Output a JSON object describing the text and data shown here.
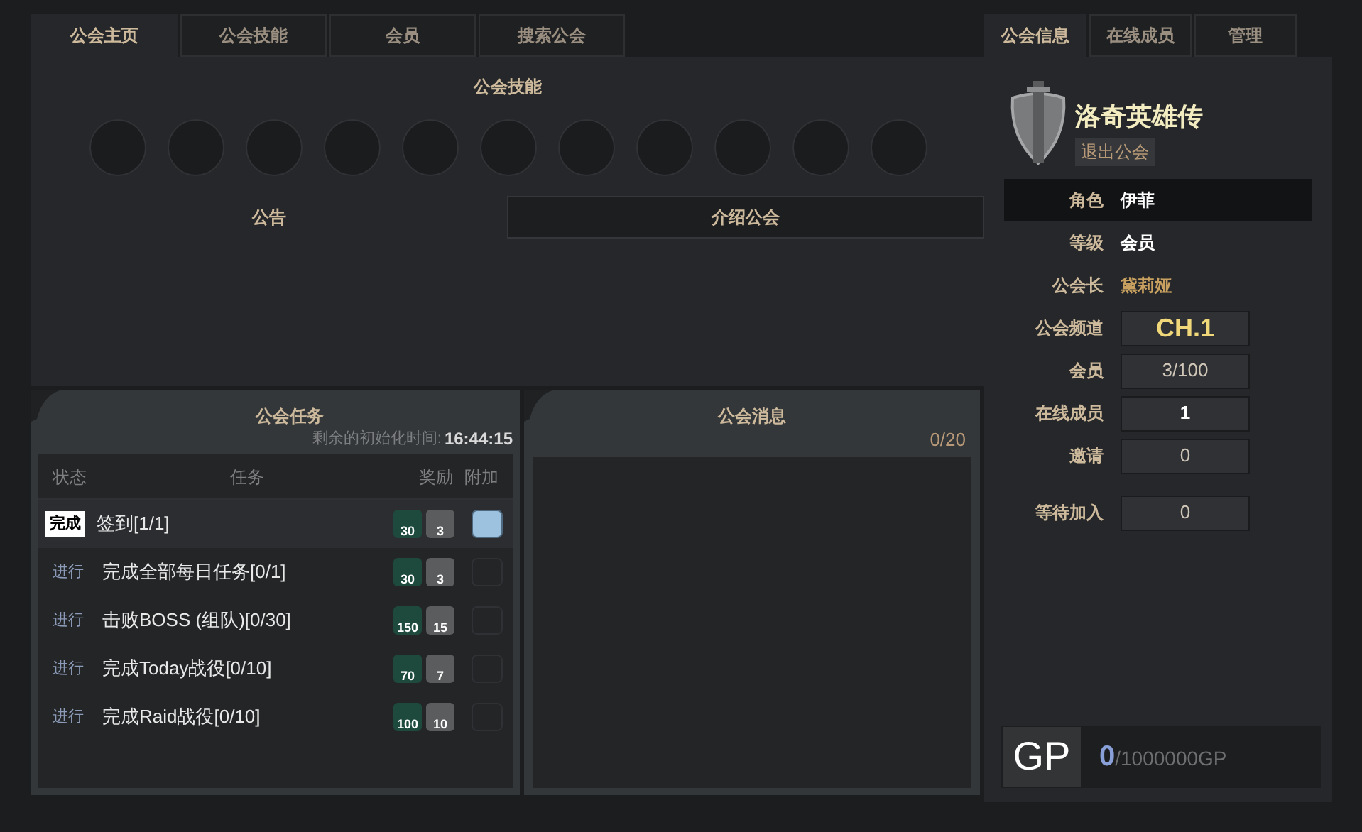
{
  "main_tabs": [
    {
      "label": "公会主页",
      "selected": true
    },
    {
      "label": "公会技能",
      "selected": false
    },
    {
      "label": "会员",
      "selected": false
    },
    {
      "label": "搜索公会",
      "selected": false
    }
  ],
  "skills": {
    "title": "公会技能",
    "slots": [
      {
        "filled": false
      },
      {
        "filled": false
      },
      {
        "filled": false
      },
      {
        "filled": false
      },
      {
        "filled": false
      },
      {
        "filled": false
      },
      {
        "filled": false
      },
      {
        "filled": false
      },
      {
        "filled": false
      },
      {
        "filled": false
      },
      {
        "filled": false
      }
    ]
  },
  "sub_tabs": [
    {
      "label": "公告",
      "selected": true
    },
    {
      "label": "介绍公会",
      "selected": false
    }
  ],
  "quests": {
    "title": "公会任务",
    "reset_label": "剩余的初始化时间:",
    "reset_time": "16:44:15",
    "columns": [
      "状态",
      "任务",
      "奖励",
      "附加"
    ],
    "rows": [
      {
        "done": true,
        "status": "完成",
        "name": "签到[1/1]",
        "gp": "30",
        "shield": "3",
        "bonus": true
      },
      {
        "done": false,
        "status": "进行",
        "name": "完成全部每日任务[0/1]",
        "gp": "30",
        "shield": "3",
        "bonus": false
      },
      {
        "done": false,
        "status": "进行",
        "name": "击败BOSS (组队)[0/30]",
        "gp": "150",
        "shield": "15",
        "bonus": false
      },
      {
        "done": false,
        "status": "进行",
        "name": "完成Today战役[0/10]",
        "gp": "70",
        "shield": "7",
        "bonus": false
      },
      {
        "done": false,
        "status": "进行",
        "name": "完成Raid战役[0/10]",
        "gp": "100",
        "shield": "10",
        "bonus": false
      }
    ]
  },
  "messages": {
    "title": "公会消息",
    "count": "0/20"
  },
  "side_tabs": [
    {
      "label": "公会信息",
      "selected": true
    },
    {
      "label": "在线成员",
      "selected": false
    },
    {
      "label": "管理",
      "selected": false
    }
  ],
  "guild": {
    "name": "洛奇英雄传",
    "leave_button": "退出公会"
  },
  "info_rows": [
    {
      "kind": "text",
      "label": "角色",
      "value": "伊菲",
      "highlighted": true
    },
    {
      "kind": "text",
      "label": "等级",
      "value": "会员",
      "highlighted": false
    },
    {
      "kind": "link",
      "label": "公会长",
      "value": "黛莉娅",
      "highlighted": false
    },
    {
      "kind": "channel",
      "label": "公会频道",
      "value": "CH.1",
      "highlighted": false
    },
    {
      "kind": "box",
      "label": "会员",
      "value": "3/100",
      "highlighted": false
    },
    {
      "kind": "box_bright",
      "label": "在线成员",
      "value": "1",
      "highlighted": false
    },
    {
      "kind": "box",
      "label": "邀请",
      "value": "0",
      "highlighted": false
    }
  ],
  "pending_rows": [
    {
      "kind": "box",
      "label": "等待加入",
      "value": "0",
      "highlighted": false
    }
  ],
  "gp": {
    "label": "GP",
    "current": "0",
    "max": "/1000000GP"
  }
}
